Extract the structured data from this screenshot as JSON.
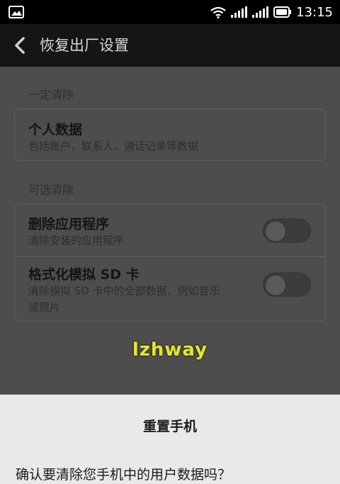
{
  "status_bar": {
    "time": "13:15"
  },
  "app_bar": {
    "title": "恢复出厂设置"
  },
  "sections": {
    "required_label": "一定清除",
    "optional_label": "可选清除"
  },
  "required_items": [
    {
      "title": "个人数据",
      "subtitle": "包括账户，联系人，通话记录等数据"
    }
  ],
  "optional_items": [
    {
      "title": "删除应用程序",
      "subtitle": "清除安装的应用程序",
      "enabled": false
    },
    {
      "title": "格式化模拟 SD 卡",
      "subtitle_line1": "清除模拟 SD 卡中的全部数据，例如音乐",
      "subtitle_line2": "或照片",
      "enabled": false
    }
  ],
  "watermark": "lzhway",
  "dialog": {
    "title": "重置手机",
    "message": "确认要清除您手机中的用户数据吗？"
  }
}
